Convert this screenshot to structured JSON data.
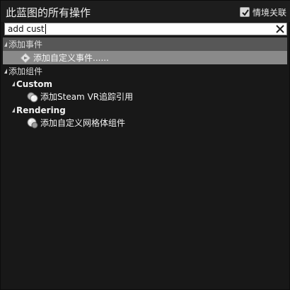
{
  "header": {
    "title": "此蓝图的所有操作",
    "context_sensitive_label": "情境关联",
    "context_sensitive_checked": true
  },
  "search": {
    "value": "add cust"
  },
  "icons": {
    "checkbox": "checkmark-icon",
    "clear": "close-icon",
    "expand": "triangle-expanded-icon",
    "event": "event-diamond-icon",
    "component": "component-sphere-icon"
  },
  "tree": {
    "categories": [
      {
        "label": "添加事件",
        "items": [
          {
            "label": "添加自定义事件......"
          }
        ]
      },
      {
        "label": "添加组件",
        "subcategories": [
          {
            "label": "Custom",
            "items": [
              {
                "label": "添加Steam VR追踪引用"
              }
            ]
          },
          {
            "label": "Rendering",
            "items": [
              {
                "label": "添加自定义网格体组件"
              }
            ]
          }
        ]
      }
    ]
  }
}
